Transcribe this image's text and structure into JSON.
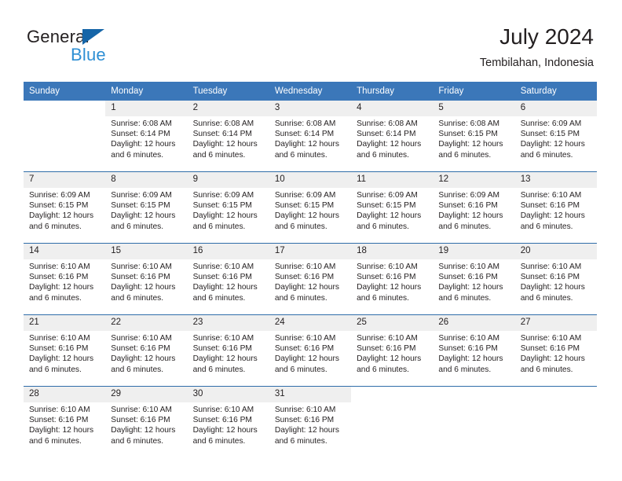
{
  "brand": {
    "name_part1": "General",
    "name_part2": "Blue",
    "triangle_color": "#1565a8",
    "blue_color": "#2e8fd4"
  },
  "header": {
    "title": "July 2024",
    "subtitle": "Tembilahan, Indonesia"
  },
  "theme": {
    "header_blue": "#3b77b9",
    "row_rule_blue": "#2f6da9",
    "daynum_band": "#efefef"
  },
  "calendar": {
    "weekday_headers": [
      "Sunday",
      "Monday",
      "Tuesday",
      "Wednesday",
      "Thursday",
      "Friday",
      "Saturday"
    ],
    "weeks": [
      [
        {
          "day": "",
          "sunrise": "",
          "sunset": "",
          "daylight_line1": "",
          "daylight_line2": "",
          "empty": true
        },
        {
          "day": "1",
          "sunrise": "Sunrise: 6:08 AM",
          "sunset": "Sunset: 6:14 PM",
          "daylight_line1": "Daylight: 12 hours",
          "daylight_line2": "and 6 minutes.",
          "empty": false
        },
        {
          "day": "2",
          "sunrise": "Sunrise: 6:08 AM",
          "sunset": "Sunset: 6:14 PM",
          "daylight_line1": "Daylight: 12 hours",
          "daylight_line2": "and 6 minutes.",
          "empty": false
        },
        {
          "day": "3",
          "sunrise": "Sunrise: 6:08 AM",
          "sunset": "Sunset: 6:14 PM",
          "daylight_line1": "Daylight: 12 hours",
          "daylight_line2": "and 6 minutes.",
          "empty": false
        },
        {
          "day": "4",
          "sunrise": "Sunrise: 6:08 AM",
          "sunset": "Sunset: 6:14 PM",
          "daylight_line1": "Daylight: 12 hours",
          "daylight_line2": "and 6 minutes.",
          "empty": false
        },
        {
          "day": "5",
          "sunrise": "Sunrise: 6:08 AM",
          "sunset": "Sunset: 6:15 PM",
          "daylight_line1": "Daylight: 12 hours",
          "daylight_line2": "and 6 minutes.",
          "empty": false
        },
        {
          "day": "6",
          "sunrise": "Sunrise: 6:09 AM",
          "sunset": "Sunset: 6:15 PM",
          "daylight_line1": "Daylight: 12 hours",
          "daylight_line2": "and 6 minutes.",
          "empty": false
        }
      ],
      [
        {
          "day": "7",
          "sunrise": "Sunrise: 6:09 AM",
          "sunset": "Sunset: 6:15 PM",
          "daylight_line1": "Daylight: 12 hours",
          "daylight_line2": "and 6 minutes.",
          "empty": false
        },
        {
          "day": "8",
          "sunrise": "Sunrise: 6:09 AM",
          "sunset": "Sunset: 6:15 PM",
          "daylight_line1": "Daylight: 12 hours",
          "daylight_line2": "and 6 minutes.",
          "empty": false
        },
        {
          "day": "9",
          "sunrise": "Sunrise: 6:09 AM",
          "sunset": "Sunset: 6:15 PM",
          "daylight_line1": "Daylight: 12 hours",
          "daylight_line2": "and 6 minutes.",
          "empty": false
        },
        {
          "day": "10",
          "sunrise": "Sunrise: 6:09 AM",
          "sunset": "Sunset: 6:15 PM",
          "daylight_line1": "Daylight: 12 hours",
          "daylight_line2": "and 6 minutes.",
          "empty": false
        },
        {
          "day": "11",
          "sunrise": "Sunrise: 6:09 AM",
          "sunset": "Sunset: 6:15 PM",
          "daylight_line1": "Daylight: 12 hours",
          "daylight_line2": "and 6 minutes.",
          "empty": false
        },
        {
          "day": "12",
          "sunrise": "Sunrise: 6:09 AM",
          "sunset": "Sunset: 6:16 PM",
          "daylight_line1": "Daylight: 12 hours",
          "daylight_line2": "and 6 minutes.",
          "empty": false
        },
        {
          "day": "13",
          "sunrise": "Sunrise: 6:10 AM",
          "sunset": "Sunset: 6:16 PM",
          "daylight_line1": "Daylight: 12 hours",
          "daylight_line2": "and 6 minutes.",
          "empty": false
        }
      ],
      [
        {
          "day": "14",
          "sunrise": "Sunrise: 6:10 AM",
          "sunset": "Sunset: 6:16 PM",
          "daylight_line1": "Daylight: 12 hours",
          "daylight_line2": "and 6 minutes.",
          "empty": false
        },
        {
          "day": "15",
          "sunrise": "Sunrise: 6:10 AM",
          "sunset": "Sunset: 6:16 PM",
          "daylight_line1": "Daylight: 12 hours",
          "daylight_line2": "and 6 minutes.",
          "empty": false
        },
        {
          "day": "16",
          "sunrise": "Sunrise: 6:10 AM",
          "sunset": "Sunset: 6:16 PM",
          "daylight_line1": "Daylight: 12 hours",
          "daylight_line2": "and 6 minutes.",
          "empty": false
        },
        {
          "day": "17",
          "sunrise": "Sunrise: 6:10 AM",
          "sunset": "Sunset: 6:16 PM",
          "daylight_line1": "Daylight: 12 hours",
          "daylight_line2": "and 6 minutes.",
          "empty": false
        },
        {
          "day": "18",
          "sunrise": "Sunrise: 6:10 AM",
          "sunset": "Sunset: 6:16 PM",
          "daylight_line1": "Daylight: 12 hours",
          "daylight_line2": "and 6 minutes.",
          "empty": false
        },
        {
          "day": "19",
          "sunrise": "Sunrise: 6:10 AM",
          "sunset": "Sunset: 6:16 PM",
          "daylight_line1": "Daylight: 12 hours",
          "daylight_line2": "and 6 minutes.",
          "empty": false
        },
        {
          "day": "20",
          "sunrise": "Sunrise: 6:10 AM",
          "sunset": "Sunset: 6:16 PM",
          "daylight_line1": "Daylight: 12 hours",
          "daylight_line2": "and 6 minutes.",
          "empty": false
        }
      ],
      [
        {
          "day": "21",
          "sunrise": "Sunrise: 6:10 AM",
          "sunset": "Sunset: 6:16 PM",
          "daylight_line1": "Daylight: 12 hours",
          "daylight_line2": "and 6 minutes.",
          "empty": false
        },
        {
          "day": "22",
          "sunrise": "Sunrise: 6:10 AM",
          "sunset": "Sunset: 6:16 PM",
          "daylight_line1": "Daylight: 12 hours",
          "daylight_line2": "and 6 minutes.",
          "empty": false
        },
        {
          "day": "23",
          "sunrise": "Sunrise: 6:10 AM",
          "sunset": "Sunset: 6:16 PM",
          "daylight_line1": "Daylight: 12 hours",
          "daylight_line2": "and 6 minutes.",
          "empty": false
        },
        {
          "day": "24",
          "sunrise": "Sunrise: 6:10 AM",
          "sunset": "Sunset: 6:16 PM",
          "daylight_line1": "Daylight: 12 hours",
          "daylight_line2": "and 6 minutes.",
          "empty": false
        },
        {
          "day": "25",
          "sunrise": "Sunrise: 6:10 AM",
          "sunset": "Sunset: 6:16 PM",
          "daylight_line1": "Daylight: 12 hours",
          "daylight_line2": "and 6 minutes.",
          "empty": false
        },
        {
          "day": "26",
          "sunrise": "Sunrise: 6:10 AM",
          "sunset": "Sunset: 6:16 PM",
          "daylight_line1": "Daylight: 12 hours",
          "daylight_line2": "and 6 minutes.",
          "empty": false
        },
        {
          "day": "27",
          "sunrise": "Sunrise: 6:10 AM",
          "sunset": "Sunset: 6:16 PM",
          "daylight_line1": "Daylight: 12 hours",
          "daylight_line2": "and 6 minutes.",
          "empty": false
        }
      ],
      [
        {
          "day": "28",
          "sunrise": "Sunrise: 6:10 AM",
          "sunset": "Sunset: 6:16 PM",
          "daylight_line1": "Daylight: 12 hours",
          "daylight_line2": "and 6 minutes.",
          "empty": false
        },
        {
          "day": "29",
          "sunrise": "Sunrise: 6:10 AM",
          "sunset": "Sunset: 6:16 PM",
          "daylight_line1": "Daylight: 12 hours",
          "daylight_line2": "and 6 minutes.",
          "empty": false
        },
        {
          "day": "30",
          "sunrise": "Sunrise: 6:10 AM",
          "sunset": "Sunset: 6:16 PM",
          "daylight_line1": "Daylight: 12 hours",
          "daylight_line2": "and 6 minutes.",
          "empty": false
        },
        {
          "day": "31",
          "sunrise": "Sunrise: 6:10 AM",
          "sunset": "Sunset: 6:16 PM",
          "daylight_line1": "Daylight: 12 hours",
          "daylight_line2": "and 6 minutes.",
          "empty": false
        },
        {
          "day": "",
          "sunrise": "",
          "sunset": "",
          "daylight_line1": "",
          "daylight_line2": "",
          "empty": true
        },
        {
          "day": "",
          "sunrise": "",
          "sunset": "",
          "daylight_line1": "",
          "daylight_line2": "",
          "empty": true
        },
        {
          "day": "",
          "sunrise": "",
          "sunset": "",
          "daylight_line1": "",
          "daylight_line2": "",
          "empty": true
        }
      ]
    ]
  }
}
